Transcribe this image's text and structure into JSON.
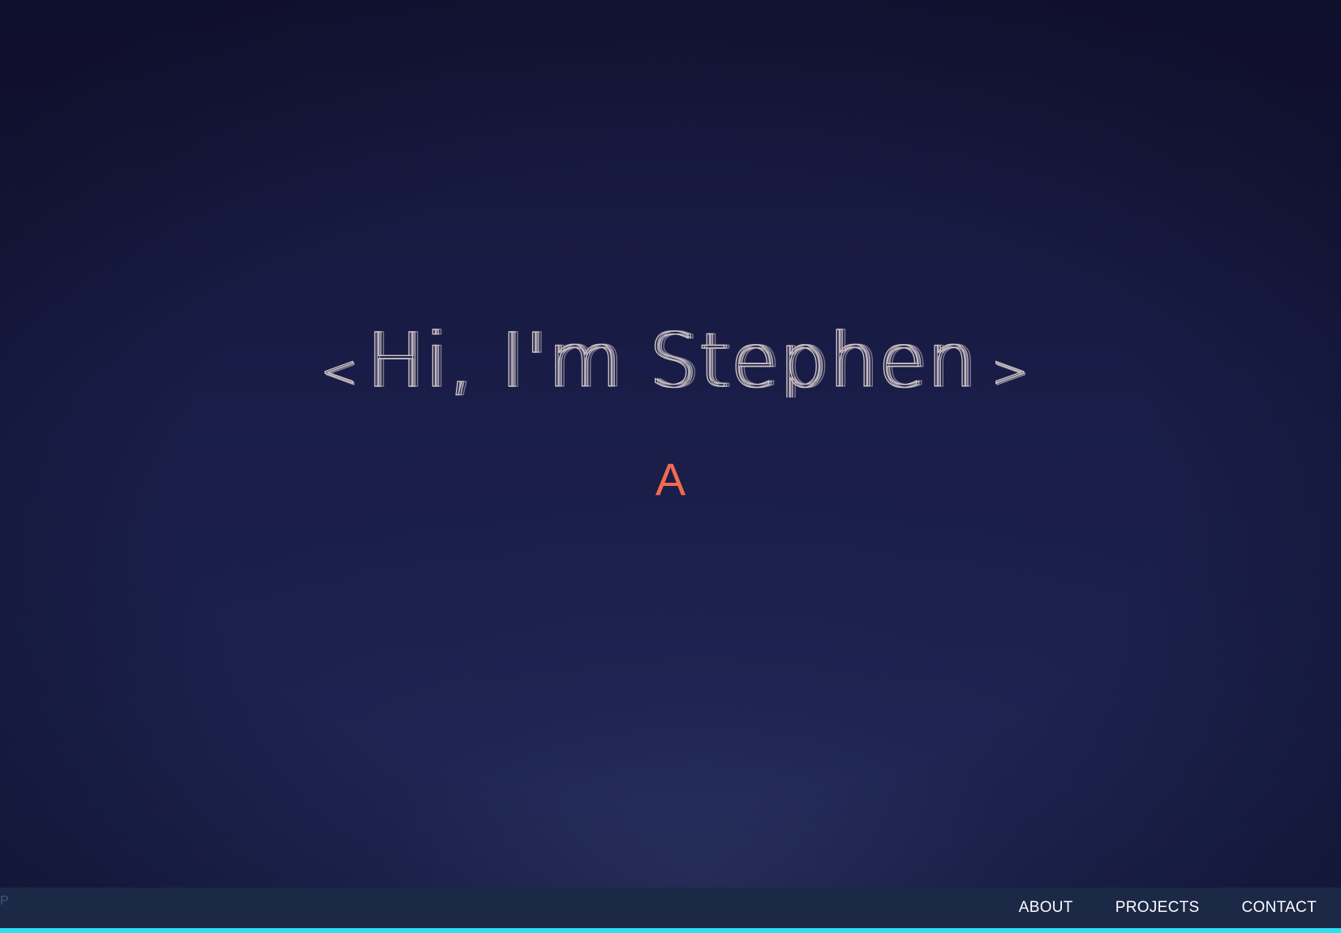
{
  "hero": {
    "headline_left_bracket": "<",
    "headline_text": "Hi, I'm Stephen",
    "headline_right_bracket": ">",
    "subtitle": "A"
  },
  "navbar": {
    "logo": "P",
    "links": [
      "ABOUT",
      "PROJECTS",
      "CONTACT"
    ]
  },
  "colors": {
    "background": "#141638",
    "headline_stroke": "#cfc4c6",
    "subtitle": "#f26a50",
    "navbar": "#1b2846",
    "navbar_accent": "#2ce0f0",
    "nav_link": "#ffffff"
  }
}
